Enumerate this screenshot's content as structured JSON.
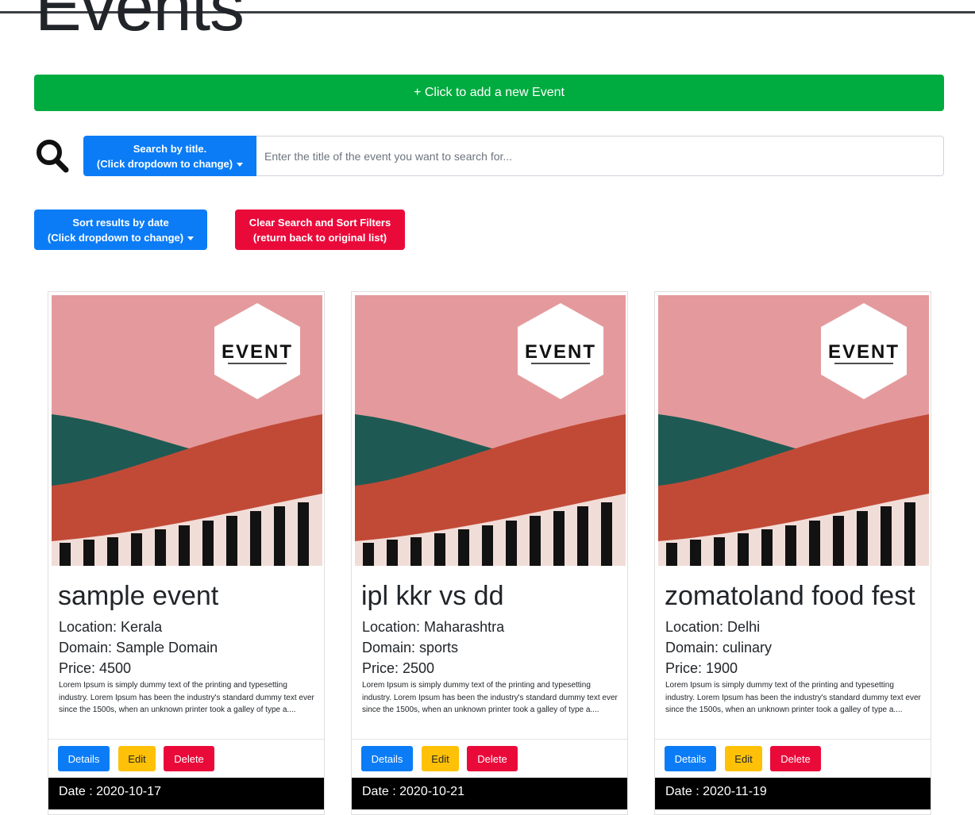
{
  "page": {
    "title": "Events"
  },
  "add_button": {
    "label": "+ Click to add a new Event"
  },
  "search": {
    "dropdown_line1": "Search by title.",
    "dropdown_line2": "(Click dropdown to change)",
    "placeholder": "Enter the title of the event you want to search for...",
    "value": ""
  },
  "sort": {
    "line1": "Sort results by date",
    "line2": "(Click dropdown to change)"
  },
  "clear": {
    "line1": "Clear Search and Sort Filters",
    "line2": "(return back to original list)"
  },
  "poster": {
    "label": "EVENT"
  },
  "buttons": {
    "details": "Details",
    "edit": "Edit",
    "delete": "Delete"
  },
  "events": [
    {
      "title": "sample event",
      "location": "Location: Kerala",
      "domain": "Domain: Sample Domain",
      "price": "Price: 4500",
      "description": "Lorem Ipsum is simply dummy text of the printing and typesetting industry. Lorem Ipsum has been the industry's standard dummy text ever since the 1500s, when an unknown printer took a galley of type a....",
      "date": "Date : 2020-10-17"
    },
    {
      "title": "ipl kkr vs dd",
      "location": "Location: Maharashtra",
      "domain": "Domain: sports",
      "price": "Price: 2500",
      "description": "Lorem Ipsum is simply dummy text of the printing and typesetting industry. Lorem Ipsum has been the industry's standard dummy text ever since the 1500s, when an unknown printer took a galley of type a....",
      "date": "Date : 2020-10-21"
    },
    {
      "title": "zomatoland food fest",
      "location": "Location: Delhi",
      "domain": "Domain: culinary",
      "price": "Price: 1900",
      "description": "Lorem Ipsum is simply dummy text of the printing and typesetting industry. Lorem Ipsum has been the industry's standard dummy text ever since the 1500s, when an unknown printer took a galley of type a....",
      "date": "Date : 2020-11-19"
    }
  ],
  "colors": {
    "success": "#00ab3f",
    "primary": "#0b7cf6",
    "danger": "#ea0a3a",
    "warning": "#ffc107",
    "poster_pink": "#e49a9c",
    "poster_teal": "#1e5a53",
    "poster_red": "#c14a37"
  }
}
